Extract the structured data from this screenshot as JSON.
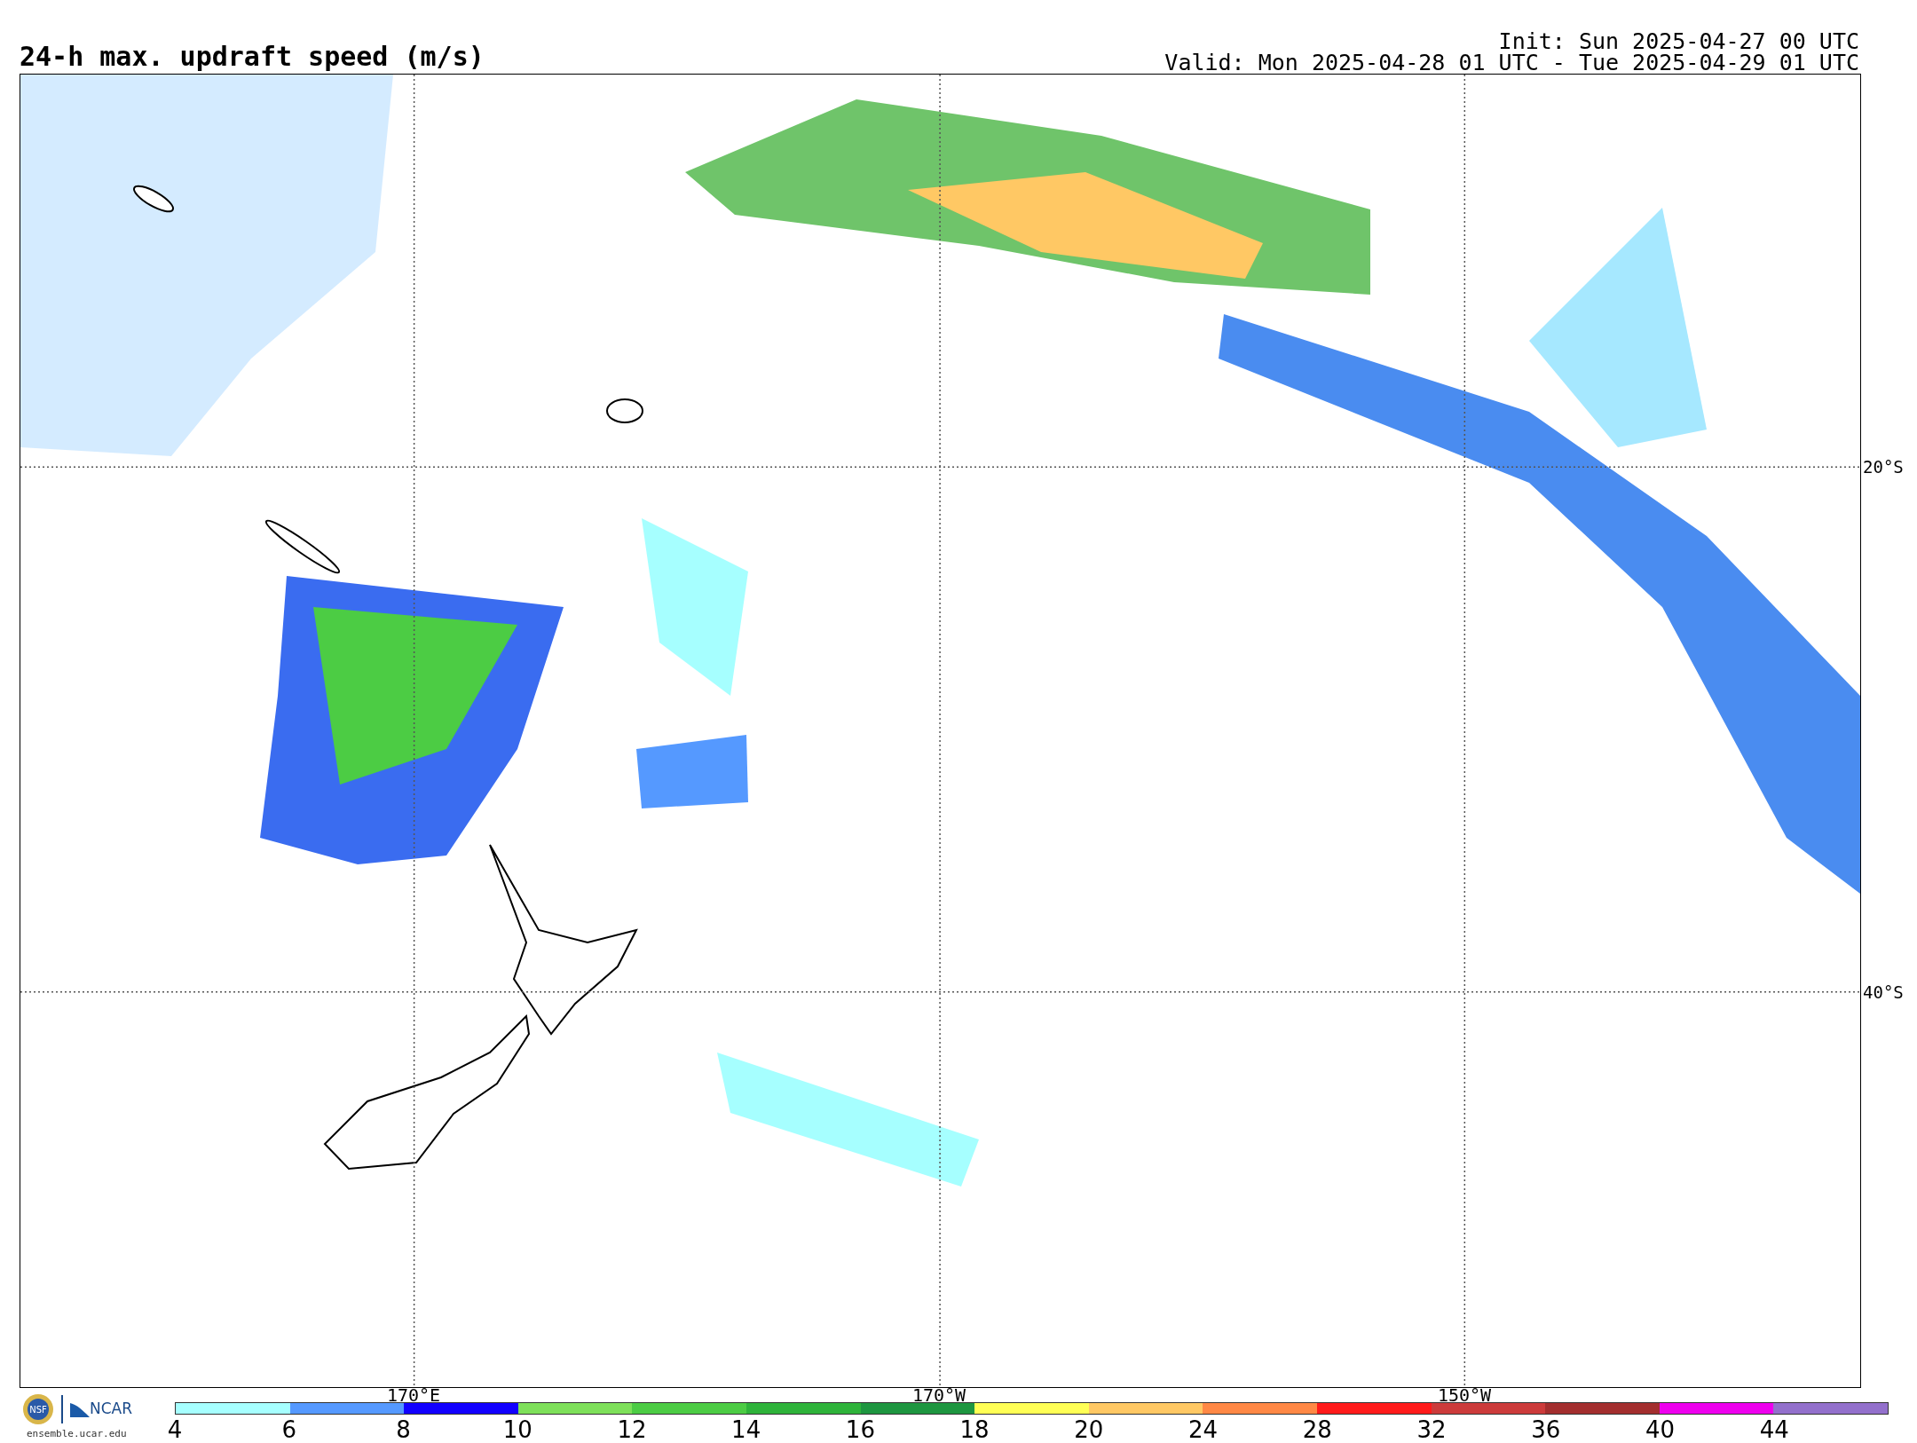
{
  "title": "24-h max. updraft speed (m/s)",
  "init": "Init: Sun 2025-04-27 00 UTC",
  "valid": "Valid: Mon 2025-04-28 01 UTC - Tue 2025-04-29 01 UTC",
  "map": {
    "lat_labels": [
      "20°S",
      "40°S"
    ],
    "lon_labels": [
      "170°E",
      "170°W",
      "150°W"
    ]
  },
  "colorbar": [
    {
      "label": "4",
      "color": "#a6ffff"
    },
    {
      "label": "6",
      "color": "#5599ff"
    },
    {
      "label": "8",
      "color": "#1100ff"
    },
    {
      "label": "10",
      "color": "#7ee05a"
    },
    {
      "label": "12",
      "color": "#4ccc44"
    },
    {
      "label": "14",
      "color": "#2eb33a"
    },
    {
      "label": "16",
      "color": "#1e9640"
    },
    {
      "label": "18",
      "color": "#ffff55"
    },
    {
      "label": "20",
      "color": "#ffc864"
    },
    {
      "label": "24",
      "color": "#ff8845"
    },
    {
      "label": "28",
      "color": "#ff1a1a"
    },
    {
      "label": "32",
      "color": "#cc3b3b"
    },
    {
      "label": "36",
      "color": "#a32e2e"
    },
    {
      "label": "40",
      "color": "#ee00ee"
    },
    {
      "label": "44",
      "color": "#9370cc"
    }
  ],
  "logo": {
    "seal": "NSF",
    "name": "NCAR",
    "url": "ensemble.ucar.edu"
  }
}
